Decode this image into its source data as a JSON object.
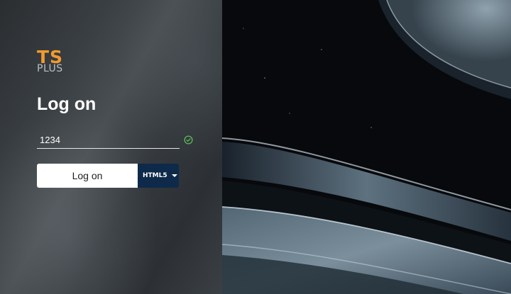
{
  "brand": {
    "logo_ts": "TS",
    "logo_plus": "PLUS"
  },
  "login": {
    "title": "Log on",
    "username_value": "1234",
    "submit_label": "Log on",
    "mode_selected": "HTML5"
  },
  "icons": {
    "valid": "check-circle-icon",
    "dropdown": "chevron-down-icon"
  },
  "colors": {
    "brand_orange": "#f29a2e",
    "mode_button": "#0e2a4a",
    "valid_green": "#5cb85c"
  }
}
